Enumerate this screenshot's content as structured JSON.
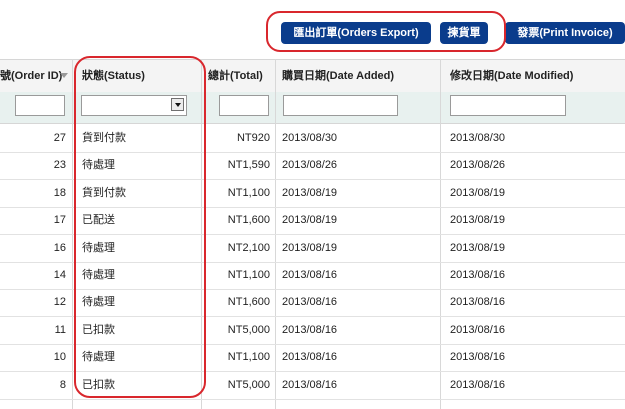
{
  "toolbar": {
    "export_label": "匯出訂單(Orders Export)",
    "picking_label": "揀貨單",
    "invoice_label": "發票(Print Invoice)"
  },
  "columns": {
    "order_id": "號(Order ID)",
    "status": "狀態(Status)",
    "total": "總計(Total)",
    "date_added": "購買日期(Date Added)",
    "date_modified": "修改日期(Date Modified)"
  },
  "filters": {
    "order_id": "",
    "status": "",
    "total": "",
    "date_added": "",
    "date_modified": ""
  },
  "orders": [
    {
      "id": "27",
      "status": "貨到付款",
      "total": "NT920",
      "added": "2013/08/30",
      "modified": "2013/08/30"
    },
    {
      "id": "23",
      "status": "待處理",
      "total": "NT1,590",
      "added": "2013/08/26",
      "modified": "2013/08/26"
    },
    {
      "id": "18",
      "status": "貨到付款",
      "total": "NT1,100",
      "added": "2013/08/19",
      "modified": "2013/08/19"
    },
    {
      "id": "17",
      "status": "已配送",
      "total": "NT1,600",
      "added": "2013/08/19",
      "modified": "2013/08/19"
    },
    {
      "id": "16",
      "status": "待處理",
      "total": "NT2,100",
      "added": "2013/08/19",
      "modified": "2013/08/19"
    },
    {
      "id": "14",
      "status": "待處理",
      "total": "NT1,100",
      "added": "2013/08/16",
      "modified": "2013/08/16"
    },
    {
      "id": "12",
      "status": "待處理",
      "total": "NT1,600",
      "added": "2013/08/16",
      "modified": "2013/08/16"
    },
    {
      "id": "11",
      "status": "已扣款",
      "total": "NT5,000",
      "added": "2013/08/16",
      "modified": "2013/08/16"
    },
    {
      "id": "10",
      "status": "待處理",
      "total": "NT1,100",
      "added": "2013/08/16",
      "modified": "2013/08/16"
    },
    {
      "id": "8",
      "status": "已扣款",
      "total": "NT5,000",
      "added": "2013/08/16",
      "modified": "2013/08/16"
    }
  ],
  "colors": {
    "button_bg": "#0a3c8c",
    "highlight": "#d9272d",
    "filter_row_bg": "#e8f1ef"
  },
  "icons": {
    "sort": "sort-desc-icon",
    "select": "chevron-down-icon"
  }
}
